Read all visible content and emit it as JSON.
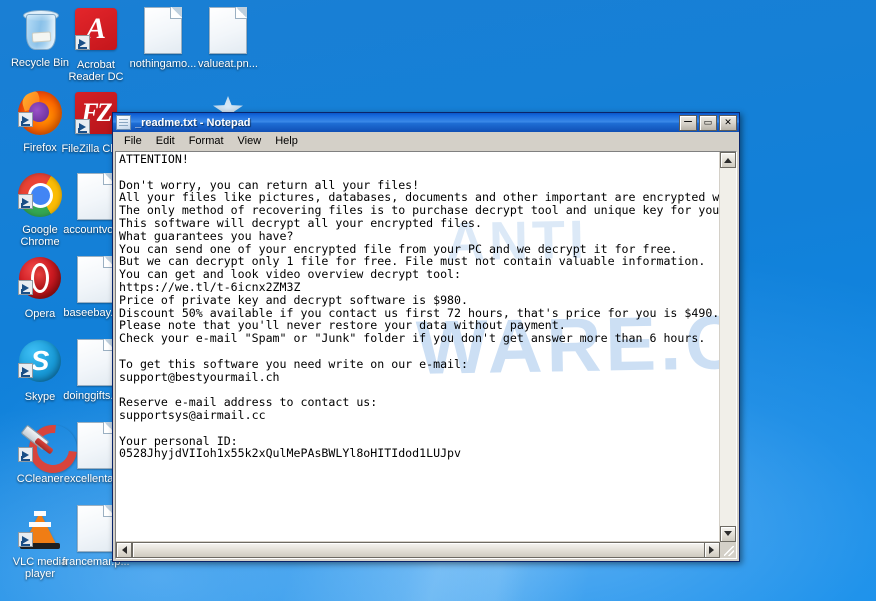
{
  "desktop": {
    "icons": [
      {
        "label": "Recycle Bin",
        "icon": "recycle-bin-icon",
        "name": "desktop-icon-recycle-bin"
      },
      {
        "label": "Acrobat\nReader DC",
        "icon": "acrobat-reader-icon",
        "name": "desktop-icon-acrobat-reader-dc"
      },
      {
        "label": "nothingamo...",
        "icon": "file-document-icon",
        "name": "desktop-icon-nothingamo"
      },
      {
        "label": "valueat.pn...",
        "icon": "file-document-icon",
        "name": "desktop-icon-valueat-png"
      },
      {
        "label": "Firefox",
        "icon": "firefox-icon",
        "name": "desktop-icon-firefox"
      },
      {
        "label": "FileZilla Clie...",
        "icon": "filezilla-icon",
        "name": "desktop-icon-filezilla-client"
      },
      {
        "label": "Google\nChrome",
        "icon": "chrome-icon",
        "name": "desktop-icon-google-chrome"
      },
      {
        "label": "accountvob...",
        "icon": "file-document-icon",
        "name": "desktop-icon-accountvob"
      },
      {
        "label": "Opera",
        "icon": "opera-icon",
        "name": "desktop-icon-opera"
      },
      {
        "label": "baseebay.p...",
        "icon": "file-document-icon",
        "name": "desktop-icon-baseebay-png"
      },
      {
        "label": "Skype",
        "icon": "skype-icon",
        "name": "desktop-icon-skype"
      },
      {
        "label": "doinggifts.p...",
        "icon": "file-document-icon",
        "name": "desktop-icon-doinggifts-png"
      },
      {
        "label": "CCleaner",
        "icon": "ccleaner-icon",
        "name": "desktop-icon-ccleaner"
      },
      {
        "label": "excellentas...",
        "icon": "file-document-icon",
        "name": "desktop-icon-excellentas"
      },
      {
        "label": "VLC media\nplayer",
        "icon": "vlc-media-player-icon",
        "name": "desktop-icon-vlc-media-player"
      },
      {
        "label": "francemar.p...",
        "icon": "file-document-icon",
        "name": "desktop-icon-francemar-png"
      }
    ],
    "background_color": "#1280d8"
  },
  "notepad": {
    "title": "_readme.txt - Notepad",
    "window_icon": "notepad-document-icon",
    "window_buttons": {
      "minimize": "–",
      "minimize_name": "minimize-button",
      "maximize": "▭",
      "maximize_name": "maximize-button",
      "close": "✕",
      "close_name": "close-button"
    },
    "menu": [
      {
        "label": "File",
        "name": "menu-file"
      },
      {
        "label": "Edit",
        "name": "menu-edit"
      },
      {
        "label": "Format",
        "name": "menu-format"
      },
      {
        "label": "View",
        "name": "menu-view"
      },
      {
        "label": "Help",
        "name": "menu-help"
      }
    ],
    "watermark_text": "WARE.C",
    "watermark_text_2": "ANTI",
    "content": "ATTENTION!\n\nDon't worry, you can return all your files!\nAll your files like pictures, databases, documents and other important are encrypted w\nThe only method of recovering files is to purchase decrypt tool and unique key for you\nThis software will decrypt all your encrypted files.\nWhat guarantees you have?\nYou can send one of your encrypted file from your PC and we decrypt it for free.\nBut we can decrypt only 1 file for free. File must not contain valuable information.\nYou can get and look video overview decrypt tool:\nhttps://we.tl/t-6icnx2ZM3Z\nPrice of private key and decrypt software is $980.\nDiscount 50% available if you contact us first 72 hours, that's price for you is $490.\nPlease note that you'll never restore your data without payment.\nCheck your e-mail \"Spam\" or \"Junk\" folder if you don't get answer more than 6 hours.\n\nTo get this software you need write on our e-mail:\nsupport@bestyourmail.ch\n\nReserve e-mail address to contact us:\nsupportsys@airmail.cc\n\nYour personal ID:\n0528JhyjdVIIoh1x55k2xQulMePAsBWLYl8oHITIdod1LUJpv",
    "ransom_details": {
      "price_full": "$980",
      "discount_percent": "50%",
      "price_discounted": "$490",
      "discount_window_hours": "72 hours",
      "answer_wait_hours": "6 hours",
      "video_url": "https://we.tl/t-6icnx2ZM3Z",
      "email_primary": "support@bestyourmail.ch",
      "email_reserve": "supportsys@airmail.cc",
      "personal_id": "0528JhyjdVIIoh1x55k2xQulMePAsBWLYl8oHITIdod1LUJpv"
    },
    "scrollbars": {
      "vertical_up": "scroll-up-arrow-icon",
      "vertical_down": "scroll-down-arrow-icon",
      "horizontal_left": "scroll-left-arrow-icon",
      "horizontal_right": "scroll-right-arrow-icon"
    }
  }
}
